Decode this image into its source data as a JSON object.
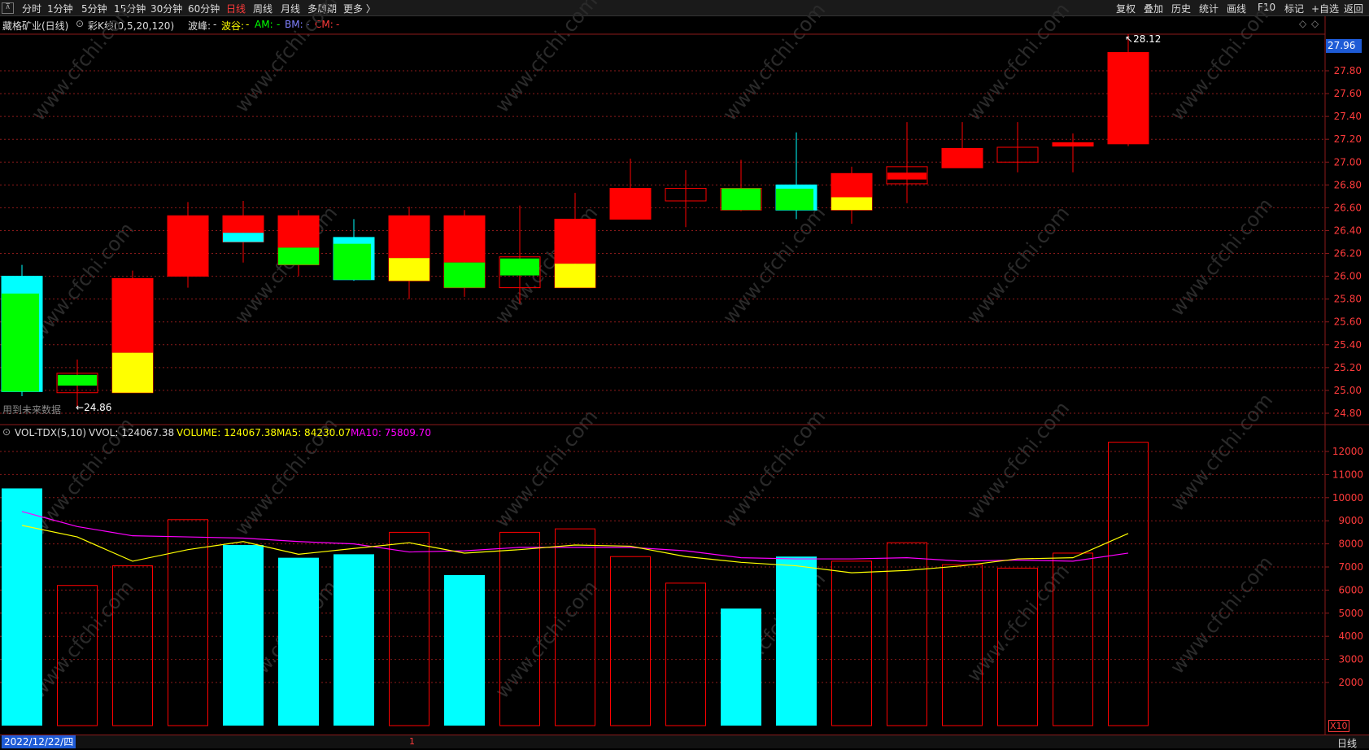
{
  "toolbar": {
    "left_tabs": [
      "分时",
      "1分钟",
      "5分钟",
      "15分钟",
      "30分钟",
      "60分钟",
      "日线",
      "周线",
      "月线",
      "多周期",
      "更多 〉"
    ],
    "active_tab": "日线",
    "right_buttons": [
      "复权",
      "叠加",
      "历史",
      "统计",
      "画线",
      "F10",
      "标记",
      "+自选",
      "返回"
    ]
  },
  "header": {
    "stock": "藏格矿业(日线)",
    "indicator": "彩K线(0,5,20,120)",
    "bofeng_label": "波峰:",
    "bofeng_val": "-",
    "bogu_label": "波谷:",
    "bogu_val": "-",
    "am_label": "AM:",
    "am_val": "-",
    "bm_label": "BM:",
    "bm_val": "-",
    "cm_label": "CM:",
    "cm_val": "-",
    "future_note": "用到未来数据"
  },
  "price_axis": {
    "ticks": [
      "27.80",
      "27.60",
      "27.40",
      "27.20",
      "27.00",
      "26.80",
      "26.60",
      "26.40",
      "26.20",
      "26.00",
      "25.80",
      "25.60",
      "25.40",
      "25.20",
      "25.00",
      "24.80"
    ],
    "current_price": "27.96",
    "high_marker": "28.12",
    "low_marker": "24.86"
  },
  "candles": [
    {
      "o": 24.99,
      "h": 26.1,
      "l": 24.95,
      "c": 26.0,
      "body": "cyan-green"
    },
    {
      "o": 25.15,
      "h": 25.27,
      "l": 24.86,
      "c": 24.98,
      "body": "green-hollow"
    },
    {
      "o": 24.98,
      "h": 26.05,
      "l": 24.98,
      "c": 25.98,
      "body": "red-yellow"
    },
    {
      "o": 26.0,
      "h": 26.65,
      "l": 25.9,
      "c": 26.53,
      "body": "red"
    },
    {
      "o": 26.53,
      "h": 26.66,
      "l": 26.12,
      "c": 26.3,
      "body": "red-cyan"
    },
    {
      "o": 26.53,
      "h": 26.58,
      "l": 26.0,
      "c": 26.1,
      "body": "red-green"
    },
    {
      "o": 26.34,
      "h": 26.5,
      "l": 25.96,
      "c": 25.97,
      "body": "cyan-green"
    },
    {
      "o": 26.53,
      "h": 26.61,
      "l": 25.8,
      "c": 25.96,
      "body": "red-yellow"
    },
    {
      "o": 26.53,
      "h": 26.58,
      "l": 25.82,
      "c": 25.9,
      "body": "red-green"
    },
    {
      "o": 26.17,
      "h": 26.62,
      "l": 25.76,
      "c": 25.9,
      "body": "green-hollow"
    },
    {
      "o": 25.9,
      "h": 26.73,
      "l": 25.9,
      "c": 26.5,
      "body": "red-yellow"
    },
    {
      "o": 26.5,
      "h": 27.03,
      "l": 26.5,
      "c": 26.77,
      "body": "red"
    },
    {
      "o": 26.77,
      "h": 26.93,
      "l": 26.43,
      "c": 26.66,
      "body": "hollow"
    },
    {
      "o": 26.77,
      "h": 27.02,
      "l": 26.57,
      "c": 26.58,
      "body": "green"
    },
    {
      "o": 26.8,
      "h": 27.26,
      "l": 26.5,
      "c": 26.58,
      "body": "cyan-green"
    },
    {
      "o": 26.58,
      "h": 26.96,
      "l": 26.46,
      "c": 26.9,
      "body": "red-yellow"
    },
    {
      "o": 26.81,
      "h": 27.35,
      "l": 26.64,
      "c": 26.96,
      "body": "red-hollow"
    },
    {
      "o": 26.95,
      "h": 27.35,
      "l": 26.95,
      "c": 27.12,
      "body": "red"
    },
    {
      "o": 27.0,
      "h": 27.35,
      "l": 26.91,
      "c": 27.13,
      "body": "hollow"
    },
    {
      "o": 27.14,
      "h": 27.25,
      "l": 26.91,
      "c": 27.17,
      "body": "red"
    },
    {
      "o": 27.16,
      "h": 28.12,
      "l": 27.14,
      "c": 27.96,
      "body": "red"
    }
  ],
  "volume": {
    "indicator": "VOL-TDX(5,10)",
    "vvol_label": "VVOL: 124067.38",
    "volume_label": "VOLUME: 124067.38",
    "ma5_label": "MA5: 84230.07",
    "ma10_label": "MA10: 75809.70",
    "axis_ticks": [
      "12000",
      "11000",
      "10000",
      "9000",
      "8000",
      "7000",
      "6000",
      "5000",
      "4000",
      "3000",
      "2000"
    ],
    "unit": "X10",
    "values": [
      10400,
      6200,
      7050,
      9050,
      7950,
      7400,
      7550,
      8500,
      6650,
      8500,
      8650,
      7450,
      6300,
      5200,
      7450,
      7250,
      8050,
      7100,
      6950,
      7600,
      12400
    ],
    "style": [
      "fill",
      "hollow",
      "hollow",
      "hollow",
      "fill",
      "fill",
      "fill",
      "hollow",
      "fill",
      "hollow",
      "hollow",
      "hollow",
      "hollow",
      "fill",
      "fill",
      "hollow",
      "hollow",
      "hollow",
      "hollow",
      "hollow",
      "hollow"
    ],
    "ma5": [
      8800,
      8300,
      7250,
      7750,
      8100,
      7550,
      7800,
      8050,
      7600,
      7750,
      7950,
      7900,
      7450,
      7200,
      7050,
      6750,
      6850,
      7050,
      7350,
      7400,
      8450
    ],
    "ma10": [
      9400,
      8750,
      8350,
      8300,
      8250,
      8100,
      8000,
      7650,
      7700,
      7850,
      7850,
      7850,
      7700,
      7400,
      7350,
      7350,
      7400,
      7250,
      7300,
      7250,
      7600
    ]
  },
  "status": {
    "date": "2022/12/22/四",
    "mid_marker": "1",
    "period": "日线"
  },
  "watermark": "www.cfchi.com",
  "colors": {
    "up": "#ff0000",
    "down_fill": "#00ffff",
    "green": "#00ff00",
    "yellow": "#ffff00",
    "ma5": "#ffff00",
    "ma10": "#ff00ff",
    "grid": "#8b1a1a"
  }
}
